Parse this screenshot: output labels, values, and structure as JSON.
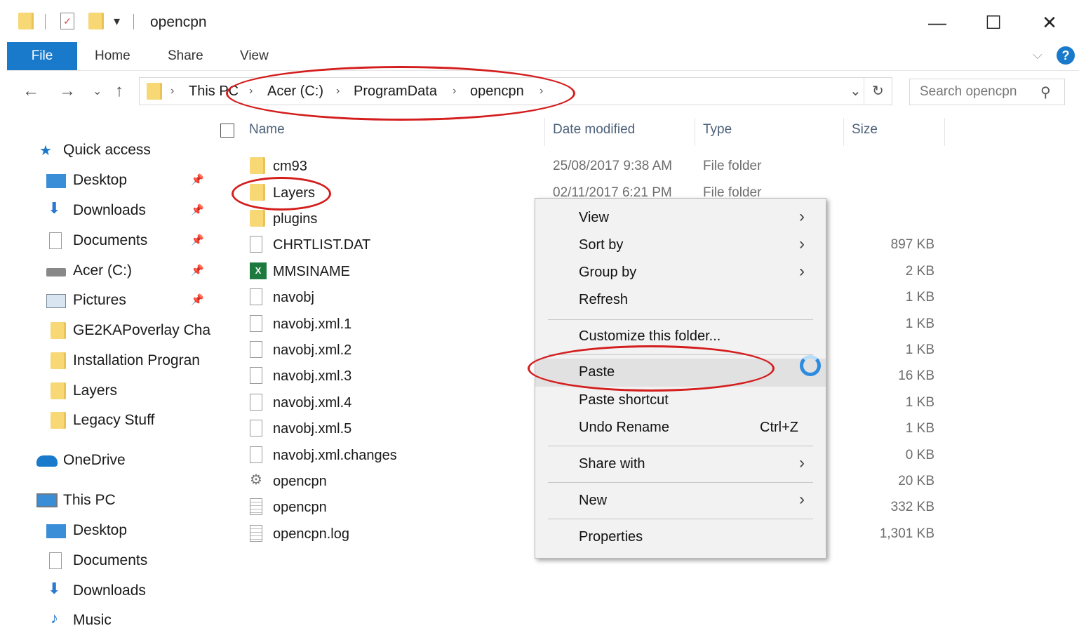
{
  "window": {
    "title": "opencpn",
    "minimize": "—",
    "maximize": "☐",
    "close": "✕",
    "qat_dropdown": "▾"
  },
  "ribbon": {
    "tabs": [
      "File",
      "Home",
      "Share",
      "View"
    ],
    "help": "?"
  },
  "address": {
    "crumbs": [
      "This PC",
      "Acer (C:)",
      "ProgramData",
      "opencpn"
    ],
    "search_placeholder": "Search opencpn"
  },
  "sidebar": {
    "items": [
      {
        "label": "Quick access",
        "icon": "star-icon",
        "pinned": false
      },
      {
        "label": "Desktop",
        "icon": "desktop-icon",
        "pinned": true
      },
      {
        "label": "Downloads",
        "icon": "download-arrow-icon",
        "pinned": true
      },
      {
        "label": "Documents",
        "icon": "documents-icon",
        "pinned": true
      },
      {
        "label": "Acer (C:)",
        "icon": "drive-icon",
        "pinned": true
      },
      {
        "label": "Pictures",
        "icon": "pictures-icon",
        "pinned": true
      },
      {
        "label": "GE2KAPoverlay Cha",
        "icon": "folder-icon",
        "pinned": false
      },
      {
        "label": "Installation Progran",
        "icon": "folder-icon",
        "pinned": false
      },
      {
        "label": "Layers",
        "icon": "folder-icon",
        "pinned": false
      },
      {
        "label": "Legacy Stuff",
        "icon": "folder-icon",
        "pinned": false
      },
      {
        "label": "OneDrive",
        "icon": "cloud-icon",
        "pinned": false
      },
      {
        "label": "This PC",
        "icon": "computer-icon",
        "pinned": false
      },
      {
        "label": "Desktop",
        "icon": "desktop-icon",
        "pinned": false
      },
      {
        "label": "Documents",
        "icon": "documents-icon",
        "pinned": false
      },
      {
        "label": "Downloads",
        "icon": "download-arrow-icon",
        "pinned": false
      },
      {
        "label": "Music",
        "icon": "music-note-icon",
        "pinned": false
      }
    ]
  },
  "columns": {
    "name": "Name",
    "date": "Date modified",
    "type": "Type",
    "size": "Size"
  },
  "files": [
    {
      "name": "cm93",
      "date": "25/08/2017 9:38 AM",
      "type": "File folder",
      "size": "",
      "icon": "folder-icon"
    },
    {
      "name": "Layers",
      "date": "02/11/2017 6:21 PM",
      "type": "File folder",
      "size": "",
      "icon": "folder-icon"
    },
    {
      "name": "plugins",
      "date": "",
      "type": "",
      "size": "",
      "icon": "folder-icon"
    },
    {
      "name": "CHRTLIST.DAT",
      "date": "",
      "type": "",
      "size": "897 KB",
      "icon": "file-icon"
    },
    {
      "name": "MMSINAME",
      "date": "",
      "type": "",
      "size": "2 KB",
      "icon": "excel-file-icon"
    },
    {
      "name": "navobj",
      "date": "",
      "type": "",
      "size": "1 KB",
      "icon": "file-icon"
    },
    {
      "name": "navobj.xml.1",
      "date": "",
      "type": "",
      "size": "1 KB",
      "icon": "file-icon"
    },
    {
      "name": "navobj.xml.2",
      "date": "",
      "type": "",
      "size": "1 KB",
      "icon": "file-icon"
    },
    {
      "name": "navobj.xml.3",
      "date": "",
      "type": "",
      "size": "16 KB",
      "icon": "file-icon"
    },
    {
      "name": "navobj.xml.4",
      "date": "",
      "type": "",
      "size": "1 KB",
      "icon": "file-icon"
    },
    {
      "name": "navobj.xml.5",
      "date": "",
      "type": "",
      "size": "1 KB",
      "icon": "file-icon"
    },
    {
      "name": "navobj.xml.changes",
      "date": "",
      "type": "",
      "size": "0 KB",
      "icon": "file-icon"
    },
    {
      "name": "opencpn",
      "date": "",
      "type": "",
      "size": "20 KB",
      "icon": "settings-file-icon"
    },
    {
      "name": "opencpn",
      "date": "",
      "type": "",
      "size": "332 KB",
      "icon": "text-file-icon"
    },
    {
      "name": "opencpn.log",
      "date": "",
      "type": "",
      "size": "1,301 KB",
      "icon": "text-file-icon"
    }
  ],
  "context_menu": {
    "items": [
      {
        "label": "View",
        "submenu": true
      },
      {
        "label": "Sort by",
        "submenu": true
      },
      {
        "label": "Group by",
        "submenu": true
      },
      {
        "label": "Refresh",
        "submenu": false
      },
      {
        "label": "Customize this folder...",
        "submenu": false
      },
      {
        "label": "Paste",
        "submenu": false,
        "highlighted": true
      },
      {
        "label": "Paste shortcut",
        "submenu": false
      },
      {
        "label": "Undo Rename",
        "submenu": false,
        "shortcut": "Ctrl+Z"
      },
      {
        "label": "Share with",
        "submenu": true
      },
      {
        "label": "New",
        "submenu": true
      },
      {
        "label": "Properties",
        "submenu": false
      }
    ]
  },
  "colors": {
    "accent": "#1979ca",
    "annotation": "#d41d1d",
    "folder": "#f8d775"
  }
}
